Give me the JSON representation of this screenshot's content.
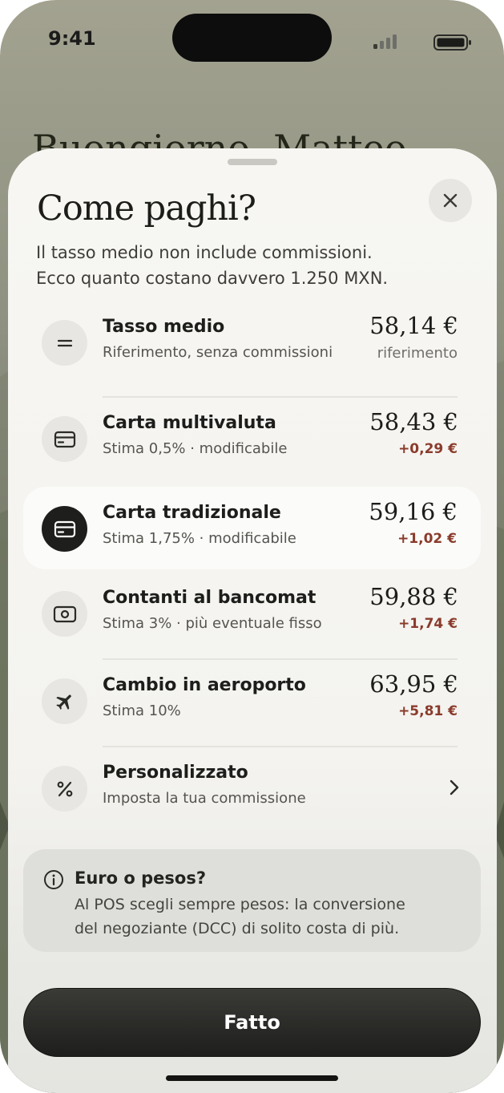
{
  "status_bar": {
    "time": "9:41"
  },
  "background": {
    "greeting": "Buongiorno, Matteo"
  },
  "sheet": {
    "title": "Come paghi?",
    "subtitle_line1": "Il tasso medio non include commissioni.",
    "subtitle_line2": "Ecco quanto costano davvero 1.250 MXN.",
    "options": [
      {
        "name": "Tasso medio",
        "description": "Riferimento, senza commissioni",
        "amount": "58,14 €",
        "note": "riferimento",
        "icon": "equals-icon"
      },
      {
        "name": "Carta multivaluta",
        "description": "Stima 0,5% · modificabile",
        "amount": "58,43 €",
        "delta": "+0,29 €",
        "icon": "card-icon"
      },
      {
        "name": "Carta tradizionale",
        "description": "Stima 1,75% · modificabile",
        "amount": "59,16 €",
        "delta": "+1,02 €",
        "icon": "card-icon",
        "selected": true
      },
      {
        "name": "Contanti al bancomat",
        "description": "Stima 3% · più eventuale fisso",
        "amount": "59,88 €",
        "delta": "+1,74 €",
        "icon": "cash-icon"
      },
      {
        "name": "Cambio in aeroporto",
        "description": "Stima 10%",
        "amount": "63,95 €",
        "delta": "+5,81 €",
        "icon": "airplane-icon"
      },
      {
        "name": "Personalizzato",
        "description": "Imposta la tua commissione",
        "icon": "percent-icon"
      }
    ],
    "info": {
      "title": "Euro o pesos?",
      "line1": "Al POS scegli sempre pesos: la conversione",
      "line2": "del negoziante (DCC) di solito costa di più."
    },
    "done_label": "Fatto"
  },
  "colors": {
    "delta": "#8a3b2c",
    "button": "#1e1e1c",
    "sheet": "#f5f4f0"
  }
}
